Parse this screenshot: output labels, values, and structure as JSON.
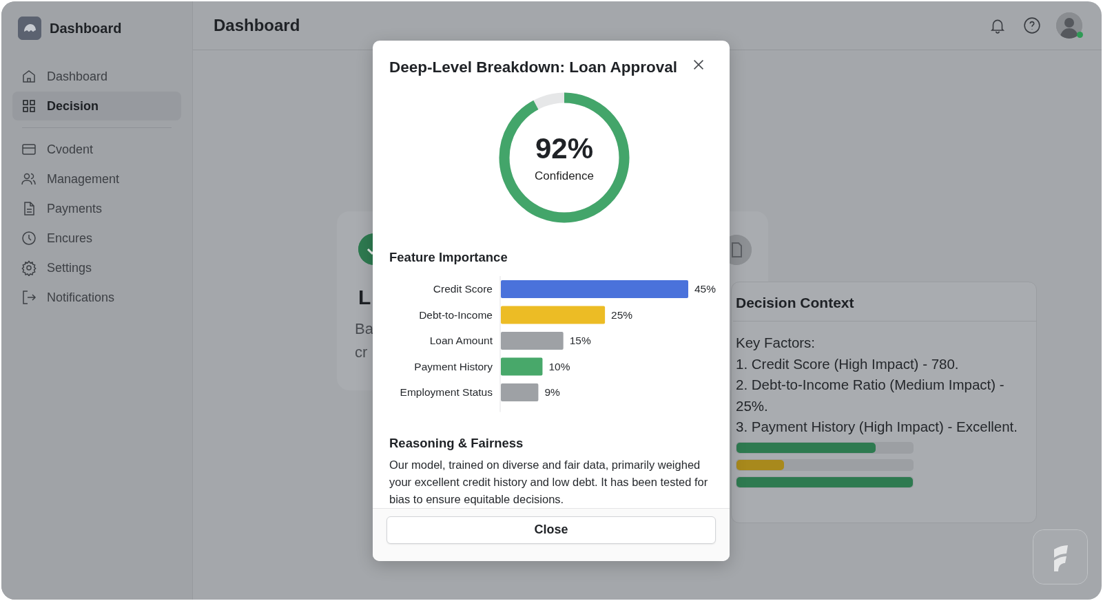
{
  "sidebar": {
    "brand": "Dashboard",
    "sections": [
      {
        "items": [
          {
            "label": "Dashboard",
            "selected": false
          },
          {
            "label": "Decision",
            "selected": true
          }
        ]
      },
      {
        "items": [
          {
            "label": "Cvodent",
            "selected": false
          },
          {
            "label": "Management",
            "selected": false
          },
          {
            "label": "Payments",
            "selected": false
          },
          {
            "label": "Encures",
            "selected": false
          },
          {
            "label": "Settings",
            "selected": false
          },
          {
            "label": "Notifications",
            "selected": false
          }
        ]
      }
    ]
  },
  "header": {
    "title": "Dashboard",
    "online": true
  },
  "background_card": {
    "heading": "L",
    "lines": [
      "Ba",
      "cr"
    ]
  },
  "modal": {
    "title": "Deep-Level Breakdown: Loan Approval",
    "confidence": {
      "level": 0.92,
      "value": "92%",
      "label": "Confidence"
    },
    "feature_importance": {
      "title": "Feature Importance",
      "chart_data": {
        "type": "bar",
        "orientation": "horizontal",
        "categories": [
          "Credit Score",
          "Debt-to-Income",
          "Loan Amount",
          "Payment History",
          "Employment Status"
        ],
        "series": [
          {
            "color": "#4a72db",
            "values": [
              45,
              null,
              null,
              null,
              null
            ],
            "value_labels": [
              "45%",
              null,
              null,
              null,
              null
            ]
          },
          {
            "color": "#ecbc25",
            "values": [
              null,
              25,
              null,
              null,
              null
            ],
            "value_labels": [
              null,
              "25%",
              null,
              null,
              null
            ]
          },
          {
            "color": "#9ea1a5",
            "values": [
              null,
              null,
              15,
              null,
              9
            ],
            "value_labels": [
              null,
              null,
              "15%",
              null,
              "9%"
            ]
          },
          {
            "color": "#48a86a",
            "values": [
              null,
              null,
              null,
              10,
              null
            ],
            "value_labels": [
              null,
              null,
              null,
              "10%",
              null
            ]
          }
        ]
      }
    },
    "reasoning": {
      "title": "Reasoning & Fairness",
      "text": "Our model, trained on diverse and fair data, primarily weighed your excellent credit history and low debt. It has been tested for bias to ensure equitable decisions."
    },
    "button": "Close"
  },
  "decision_context": {
    "title": "Decision Context",
    "lines": [
      "Key Factors:",
      "1. Credit Score (High Impact) - 780.",
      "2. Debt-to-Income Ratio (Medium Impact) - 25%.",
      "3. Payment History (High Impact) - Excellent."
    ],
    "bars": [
      {
        "level": 0.79,
        "color": "#2e7a50"
      },
      {
        "level": 0.27,
        "color": "#a8891c"
      },
      {
        "level": 1,
        "color": "#2e7a50"
      }
    ]
  }
}
